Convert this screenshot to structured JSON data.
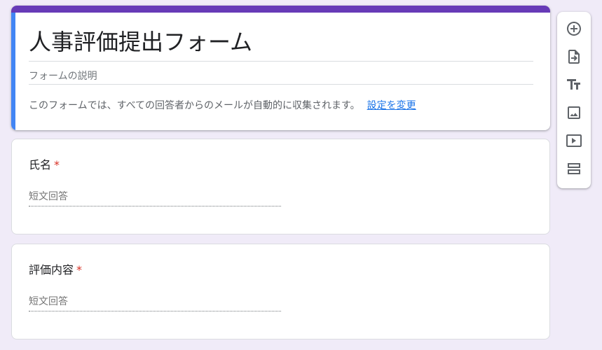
{
  "form": {
    "title": "人事評価提出フォーム",
    "description_placeholder": "フォームの説明",
    "email_notice": "このフォームでは、すべての回答者からのメールが自動的に収集されます。",
    "email_settings_link": "設定を変更",
    "accent_color": "#673ab7",
    "active_indicator_color": "#4285f4"
  },
  "questions": [
    {
      "title": "氏名",
      "required_mark": "*",
      "answer_placeholder": "短文回答"
    },
    {
      "title": "評価内容",
      "required_mark": "*",
      "answer_placeholder": "短文回答"
    }
  ],
  "toolbar": {
    "tools": [
      {
        "icon": "add-question-icon"
      },
      {
        "icon": "import-questions-icon"
      },
      {
        "icon": "add-title-icon"
      },
      {
        "icon": "add-image-icon"
      },
      {
        "icon": "add-video-icon"
      },
      {
        "icon": "add-section-icon"
      }
    ]
  }
}
